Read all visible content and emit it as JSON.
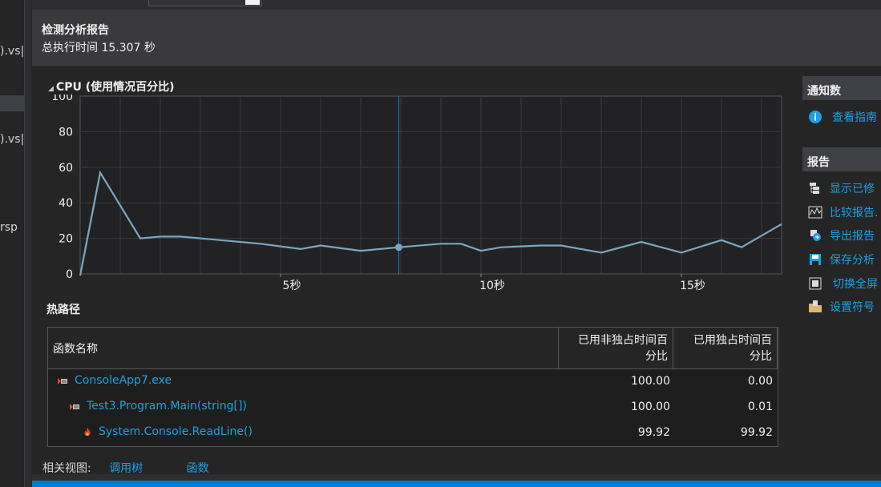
{
  "left_items": [
    ").vs|",
    ").vs|",
    "rsp"
  ],
  "report": {
    "title": "检测分析报告",
    "exec_time": "总执行时间 15.307 秒"
  },
  "cpu_section": {
    "title": "CPU (使用情况百分比)",
    "collapse_glyph": "◢"
  },
  "chart_data": {
    "type": "line",
    "title": "CPU (使用情况百分比)",
    "xlabel": "",
    "ylabel": "",
    "ylim": [
      0,
      100
    ],
    "xlim": [
      0,
      17.5
    ],
    "yticks": [
      "0",
      "20",
      "40",
      "60",
      "80",
      "100"
    ],
    "xticks": [
      {
        "value": 5,
        "label": "5秒"
      },
      {
        "value": 10,
        "label": "10秒"
      },
      {
        "value": 15,
        "label": "15秒"
      }
    ],
    "grid": true,
    "cursor_x": 7.95,
    "line_color": "#7aa6c2",
    "cursor_color": "#1e7bc4",
    "series": [
      {
        "x": [
          0,
          0.5,
          1.5,
          2.0,
          2.5,
          3.5,
          4.5,
          5.5,
          6.0,
          7.0,
          7.95,
          9.0,
          9.5,
          10.0,
          10.5,
          11.5,
          12.0,
          13.0,
          14.0,
          15.0,
          16.0,
          16.5,
          17.5
        ],
        "y": [
          -3,
          57,
          20,
          21,
          21,
          19,
          17,
          14,
          16,
          13,
          15,
          17,
          17,
          13,
          15,
          16,
          16,
          12,
          18,
          12,
          19,
          15,
          28
        ]
      }
    ]
  },
  "hot_path": {
    "title": "热路径",
    "columns": [
      "函数名称",
      "已用非独占时间百分比",
      "已用独占时间百分比"
    ],
    "col_inclusive_lines": [
      "已用非独占时间百",
      "分比"
    ],
    "col_exclusive_lines": [
      "已用独占时间百",
      "分比"
    ],
    "rows": [
      {
        "name": "ConsoleApp7.exe",
        "icon": "hot-path-icon",
        "inclusive": "100.00",
        "exclusive": "0.00"
      },
      {
        "name": "Test3.Program.Main(string[])",
        "icon": "hot-path-icon",
        "inclusive": "100.00",
        "exclusive": "0.01"
      },
      {
        "name": "System.Console.ReadLine()",
        "icon": "flame-icon",
        "inclusive": "99.92",
        "exclusive": "99.92"
      }
    ]
  },
  "related": {
    "label": "相关视图:",
    "links": [
      "调用树",
      "函数"
    ]
  },
  "right_panel": {
    "notifications_header": "通知数",
    "notification_link": "查看指南",
    "report_header": "报告",
    "report_links": [
      {
        "label": "显示已修",
        "icon": "trimmed-calltree-icon"
      },
      {
        "label": "比较报告.",
        "icon": "compare-icon"
      },
      {
        "label": "导出报告",
        "icon": "export-icon"
      },
      {
        "label": "保存分析",
        "icon": "save-icon"
      },
      {
        "label": "切换全屏",
        "icon": "fullscreen-icon"
      },
      {
        "label": "设置符号",
        "icon": "symbol-folder-icon"
      }
    ]
  },
  "colors": {
    "link": "#1ba1e2",
    "background": "#252526",
    "header": "#3a3a3d",
    "accent": "#007acc"
  }
}
